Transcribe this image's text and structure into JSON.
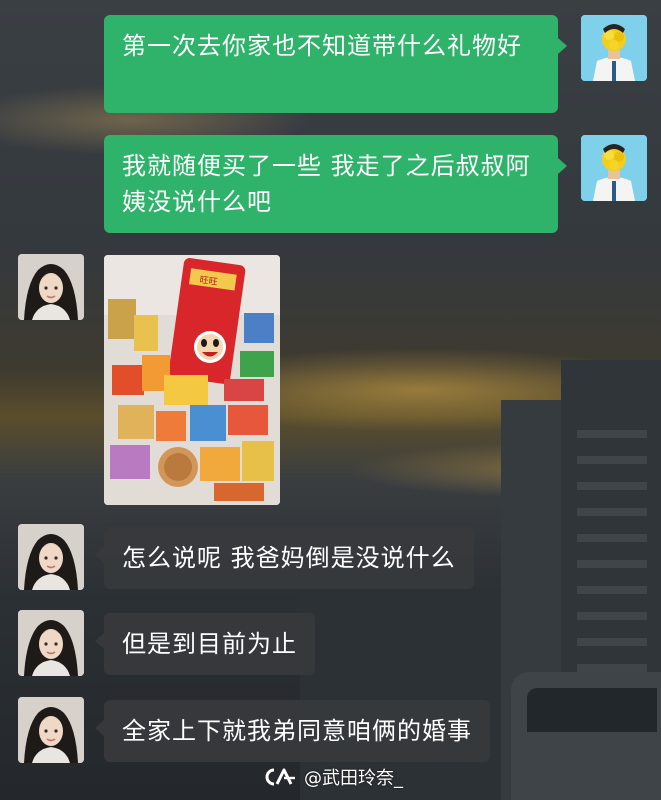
{
  "messages": [
    {
      "side": "sent",
      "text": "第一次去你家也不知道带什么礼物好"
    },
    {
      "side": "sent",
      "text": "我就随便买了一些 我走了之后叔叔阿姨没说什么吧"
    },
    {
      "side": "recv",
      "type": "image",
      "text": "旺旺"
    },
    {
      "side": "recv",
      "text": "怎么说呢 我爸妈倒是没说什么"
    },
    {
      "side": "recv",
      "text": "但是到目前为止"
    },
    {
      "side": "recv",
      "text": "全家上下就我弟同意咱俩的婚事"
    }
  ],
  "watermark": {
    "text": "@武田玲奈_",
    "icon": "app-logo-icon"
  },
  "colors": {
    "sent_bubble": "#2fb36a",
    "recv_bubble": "#37393d"
  }
}
